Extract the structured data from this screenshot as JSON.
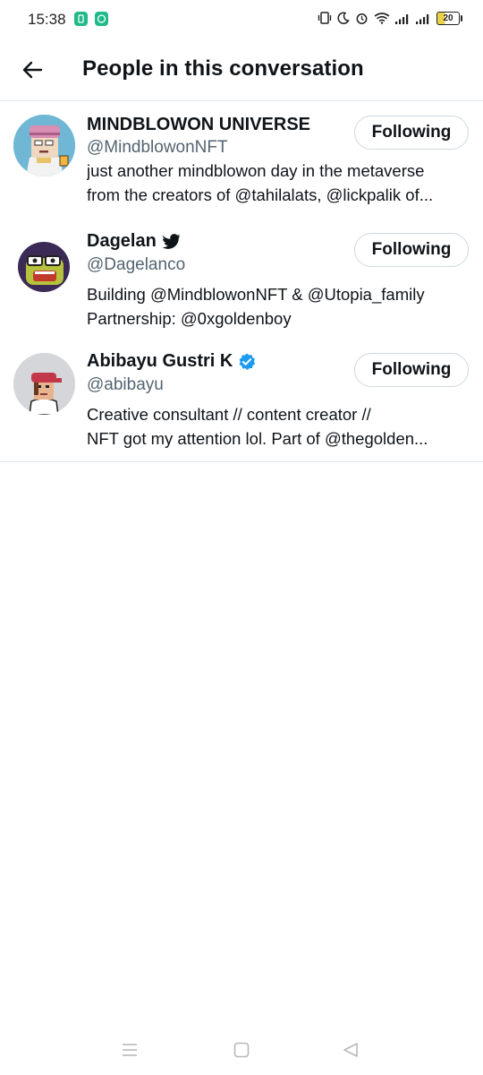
{
  "status_bar": {
    "time": "15:38",
    "battery": "20",
    "icons": [
      "vibrate-icon",
      "moon-icon",
      "alarm-icon",
      "wifi-icon",
      "signal-icon",
      "signal-icon",
      "battery-icon"
    ]
  },
  "header": {
    "title": "People in this conversation",
    "back_icon": "arrow-left-icon"
  },
  "people": [
    {
      "name": "MINDBLOWON UNIVERSE",
      "handle": "@MindblowonNFT",
      "badge": "",
      "bio_lines": [
        "just another mindblowon day in the metaverse",
        "from the creators of @tahilalats, @lickpalik of..."
      ],
      "button": "Following"
    },
    {
      "name": "Dagelan",
      "handle": "@Dagelanco",
      "badge": "bird-icon",
      "bio_lines": [
        "Building @MindblowonNFT & @Utopia_family",
        "Partnership: @0xgoldenboy"
      ],
      "button": "Following"
    },
    {
      "name": "Abibayu Gustri K",
      "handle": "@abibayu",
      "badge": "verified-icon",
      "bio_lines": [
        "Creative consultant // content creator //",
        "NFT got my attention lol. Part of @thegolden..."
      ],
      "button": "Following"
    }
  ],
  "colors": {
    "text": "#0f1419",
    "secondary": "#536471",
    "verified": "#1d9bf0",
    "border": "#cfd9de"
  },
  "nav": [
    "menu-icon",
    "home-square-icon",
    "back-triangle-icon"
  ]
}
